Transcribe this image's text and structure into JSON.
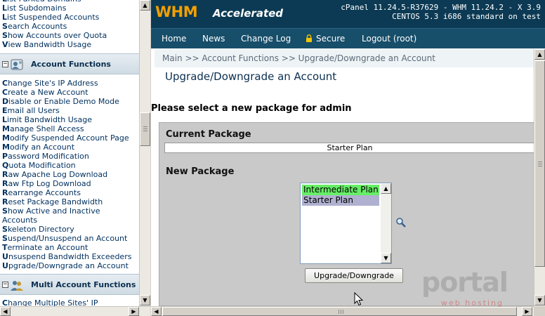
{
  "sidebar": {
    "group1_items": [
      {
        "first": "L",
        "rest": "ist Parked Domains"
      },
      {
        "first": "L",
        "rest": "ist Subdomains"
      },
      {
        "first": "L",
        "rest": "ist Suspended Accounts"
      },
      {
        "first": "S",
        "rest": "earch Accounts"
      },
      {
        "first": "S",
        "rest": "how Accounts over Quota"
      },
      {
        "first": "V",
        "rest": "iew Bandwidth Usage"
      }
    ],
    "account_functions": {
      "title": "Account Functions",
      "toggle": "−",
      "items": [
        {
          "first": "C",
          "rest": "hange Site's IP Address"
        },
        {
          "first": "C",
          "rest": "reate a New Account"
        },
        {
          "first": "D",
          "rest": "isable or Enable Demo Mode"
        },
        {
          "first": "E",
          "rest": "mail all Users"
        },
        {
          "first": "L",
          "rest": "imit Bandwidth Usage"
        },
        {
          "first": "M",
          "rest": "anage Shell Access"
        },
        {
          "first": "M",
          "rest": "odify Suspended Account Page"
        },
        {
          "first": "M",
          "rest": "odify an Account"
        },
        {
          "first": "P",
          "rest": "assword Modification"
        },
        {
          "first": "Q",
          "rest": "uota Modification"
        },
        {
          "first": "R",
          "rest": "aw Apache Log Download"
        },
        {
          "first": "R",
          "rest": "aw Ftp Log Download"
        },
        {
          "first": "R",
          "rest": "earrange Accounts"
        },
        {
          "first": "R",
          "rest": "eset Package Bandwidth"
        },
        {
          "first": "S",
          "rest": "how Active and Inactive"
        },
        {
          "first": "",
          "rest": "Accounts"
        },
        {
          "first": "S",
          "rest": "keleton Directory"
        },
        {
          "first": "S",
          "rest": "uspend/Unsuspend an Account"
        },
        {
          "first": "T",
          "rest": "erminate an Account"
        },
        {
          "first": "U",
          "rest": "nsuspend Bandwidth Exceeders"
        },
        {
          "first": "U",
          "rest": "pgrade/Downgrade an Account"
        }
      ]
    },
    "multi_account_functions": {
      "title": "Multi Account Functions",
      "toggle": "−",
      "items": [
        {
          "first": "C",
          "rest": "hange Multiple Sites' IP"
        }
      ]
    }
  },
  "header": {
    "logo_main": "WHM",
    "logo_sub": "Accelerated",
    "version_line1": "cPanel 11.24.5-R37629 - WHM 11.24.2 - X 3.9",
    "version_line2": "CENTOS 5.3 i686 standard on test"
  },
  "nav": {
    "home": "Home",
    "news": "News",
    "changelog": "Change Log",
    "secure": "Secure",
    "logout": "Logout (root)"
  },
  "breadcrumb": "Main >> Account Functions >> Upgrade/Downgrade an Account",
  "page_title": "Upgrade/Downgrade an Account",
  "instruction": "Please select a new package for admin",
  "current_package": {
    "label": "Current Package",
    "value": "Starter Plan"
  },
  "new_package": {
    "label": "New Package",
    "options": [
      "Intermediate Plan",
      "Starter Plan"
    ],
    "selected": "Intermediate Plan"
  },
  "submit_label": "Upgrade/Downgrade",
  "watermark": {
    "brand": "portal",
    "sub": "web hosting"
  },
  "colors": {
    "topbar": "#0c3a54",
    "navbar": "#174e6a",
    "logo_accent": "#f1a000",
    "selected_option": "#66ee66",
    "highlight_option": "#b0b0d0"
  }
}
